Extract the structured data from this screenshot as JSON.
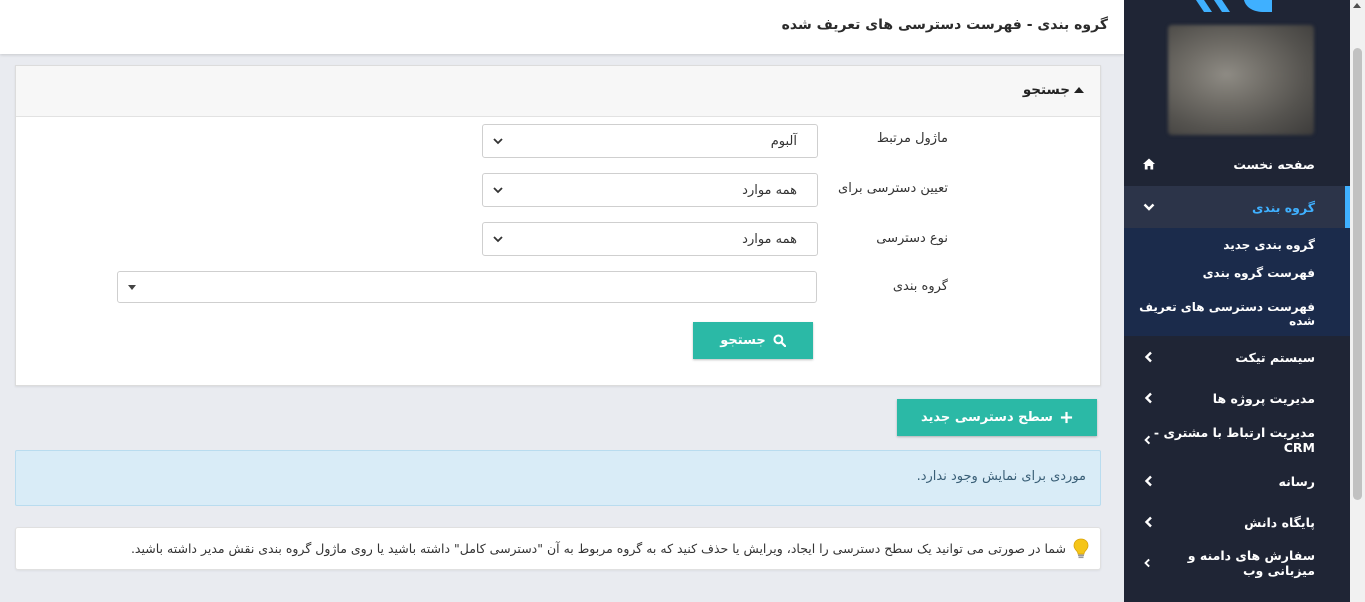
{
  "header": {
    "title": "گروه بندی - فهرست دسترسی های تعریف شده"
  },
  "search_panel": {
    "title": "جستجو",
    "fields": [
      {
        "label": "ماژول مرتبط",
        "value": "آلبوم"
      },
      {
        "label": "تعیین دسترسی برای",
        "value": "همه موارد"
      },
      {
        "label": "نوع دسترسی",
        "value": "همه موارد"
      },
      {
        "label": "گروه بندی",
        "value": ""
      }
    ],
    "search_button": "جستجو"
  },
  "new_access_button": "سطح دسترسی جدید",
  "empty_message": "موردی برای نمایش وجود ندارد.",
  "note": "شما در صورتی می توانید یک سطح دسترسی را ایجاد، ویرایش یا حذف کنید که به گروه مربوط به آن \"دسترسی کامل\" داشته باشید یا روی ماژول گروه بندی نقش مدیر داشته باشید.",
  "sidebar": {
    "items": [
      {
        "label": "صفحه نخست",
        "icon": "home-icon"
      },
      {
        "label": "گروه بندی",
        "icon": "chevron-down-icon",
        "active": true
      },
      {
        "label": "سیستم تیکت",
        "icon": "chevron-left-icon"
      },
      {
        "label": "مدیریت پروژه ها",
        "icon": "chevron-left-icon"
      },
      {
        "label": "مدیریت ارتباط با مشتری - CRM",
        "icon": "chevron-left-icon"
      },
      {
        "label": "رسانه",
        "icon": "chevron-left-icon"
      },
      {
        "label": "پایگاه دانش",
        "icon": "chevron-left-icon"
      },
      {
        "label": "سفارش های دامنه و میزبانی وب",
        "icon": "chevron-left-icon"
      }
    ],
    "submenu": [
      {
        "label": "گروه بندی جدید"
      },
      {
        "label": "فهرست گروه بندی"
      },
      {
        "label": "فهرست دسترسی های تعریف شده"
      }
    ]
  },
  "colors": {
    "accent": "#2bb9a6",
    "sidebar_bg": "#1f2535",
    "active_link": "#3fb0ff"
  }
}
